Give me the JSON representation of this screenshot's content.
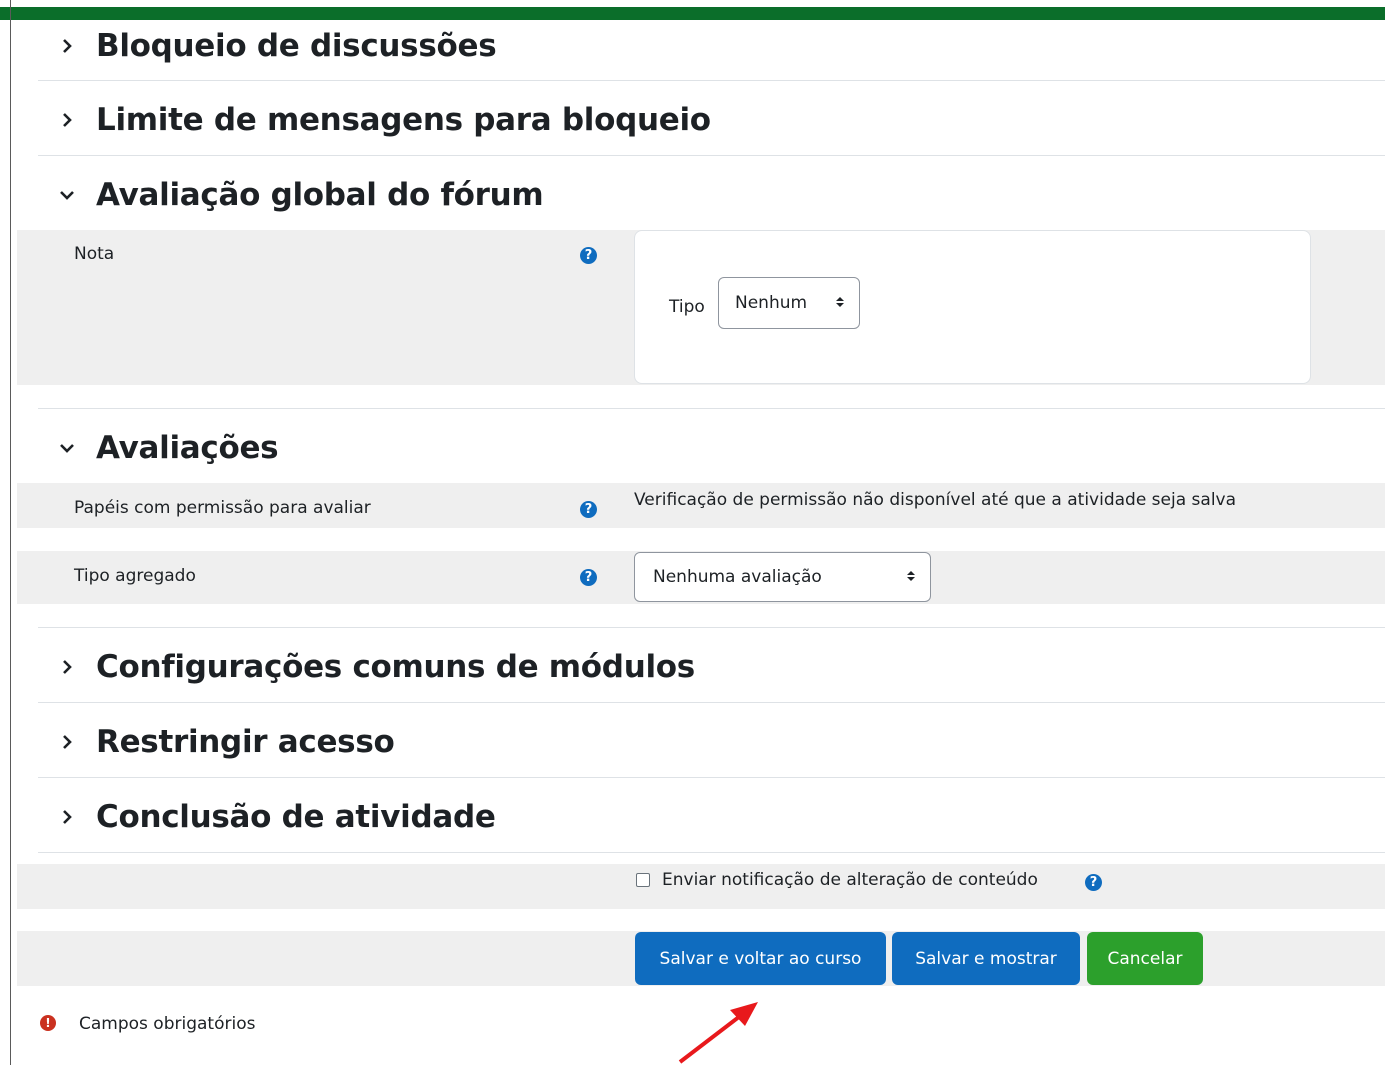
{
  "sections": {
    "discussion_lock": "Bloqueio de discussões",
    "post_threshold": "Limite de mensagens para bloqueio",
    "whole_forum_grading": "Avaliação global do fórum",
    "ratings": "Avaliações",
    "common_module_settings": "Configurações comuns de módulos",
    "restrict_access": "Restringir acesso",
    "activity_completion": "Conclusão de atividade"
  },
  "grade": {
    "label": "Nota",
    "type_label": "Tipo",
    "type_value": "Nenhum"
  },
  "ratings": {
    "roles_label": "Papéis com permissão para avaliar",
    "roles_value": "Verificação de permissão não disponível até que a atividade seja salva",
    "aggregate_label": "Tipo agregado",
    "aggregate_value": "Nenhuma avaliação"
  },
  "notify": {
    "label": "Enviar notificação de alteração de conteúdo",
    "checked": false
  },
  "buttons": {
    "save_return": "Salvar e voltar ao curso",
    "save_display": "Salvar e mostrar",
    "cancel": "Cancelar"
  },
  "required_note": "Campos obrigatórios",
  "colors": {
    "primary": "#0f6cbf",
    "success": "#2ca02c",
    "topbar": "#0b6e2a",
    "required": "#ca3120",
    "annotation_arrow": "#e8191c"
  }
}
